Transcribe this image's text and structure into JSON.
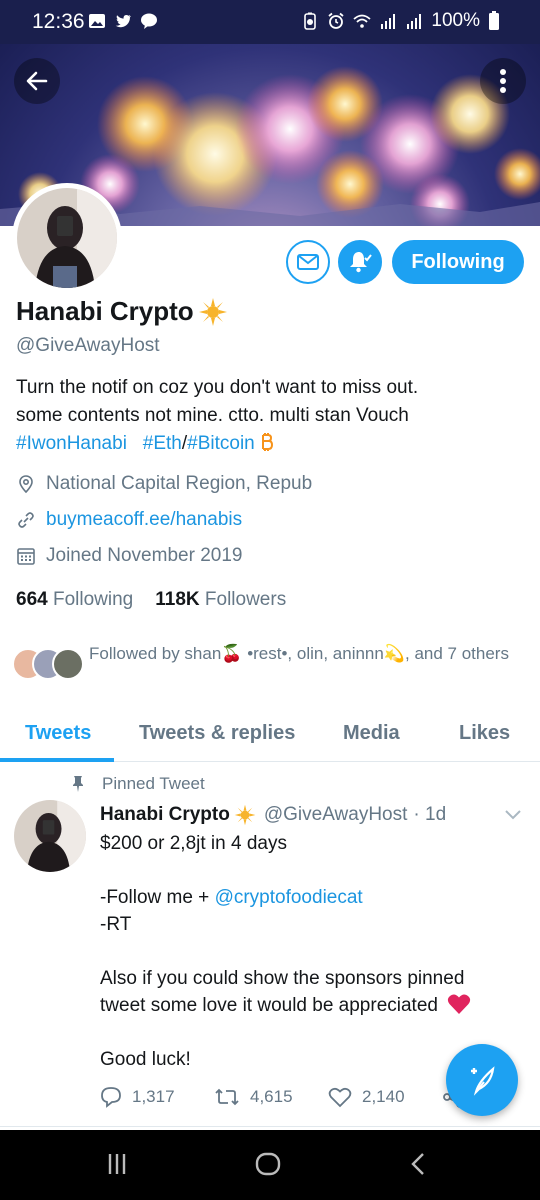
{
  "status_bar": {
    "time": "12:36",
    "battery": "100%"
  },
  "profile": {
    "name": "Hanabi Crypto",
    "handle": "@GiveAwayHost",
    "bio_line1": "Turn the notif on coz you don't want to miss out.",
    "bio_line2": "some contents not mine. ctto. multi stan Vouch",
    "hashtag1": "#IwonHanabi",
    "hashtag2": "#Eth",
    "slash": "/",
    "hashtag3": "#Bitcoin",
    "location": "National Capital Region, Repub",
    "website": "buymeacoff.ee/hanabis",
    "joined": "Joined November 2019",
    "following_count": "664",
    "following_label": "Following",
    "followers_count": "118K",
    "followers_label": "Followers",
    "followed_by": "Followed by shan🍒 •rest•, olin, aninnn💫, and 7 others",
    "follow_button": "Following"
  },
  "tabs": [
    "Tweets",
    "Tweets & replies",
    "Media",
    "Likes"
  ],
  "tweet": {
    "pinned_label": "Pinned Tweet",
    "author_name": "Hanabi Crypto",
    "author_handle": "@GiveAwayHost",
    "time": "· 1d",
    "line1": "$200 or 2,8jt in 4 days",
    "line2_pre": "-Follow me + ",
    "line2_mention": "@cryptofoodiecat",
    "line3": "-RT",
    "line4": "Also if you could show the sponsors pinned",
    "line5": "tweet some love it would be appreciated",
    "line6": "Good luck!",
    "replies": "1,317",
    "retweets": "4,615",
    "likes": "2,140"
  },
  "colors": {
    "accent": "#1da1f2",
    "link": "#1b95e0",
    "muted": "#657786",
    "status_bar": "#1a1f4d"
  }
}
